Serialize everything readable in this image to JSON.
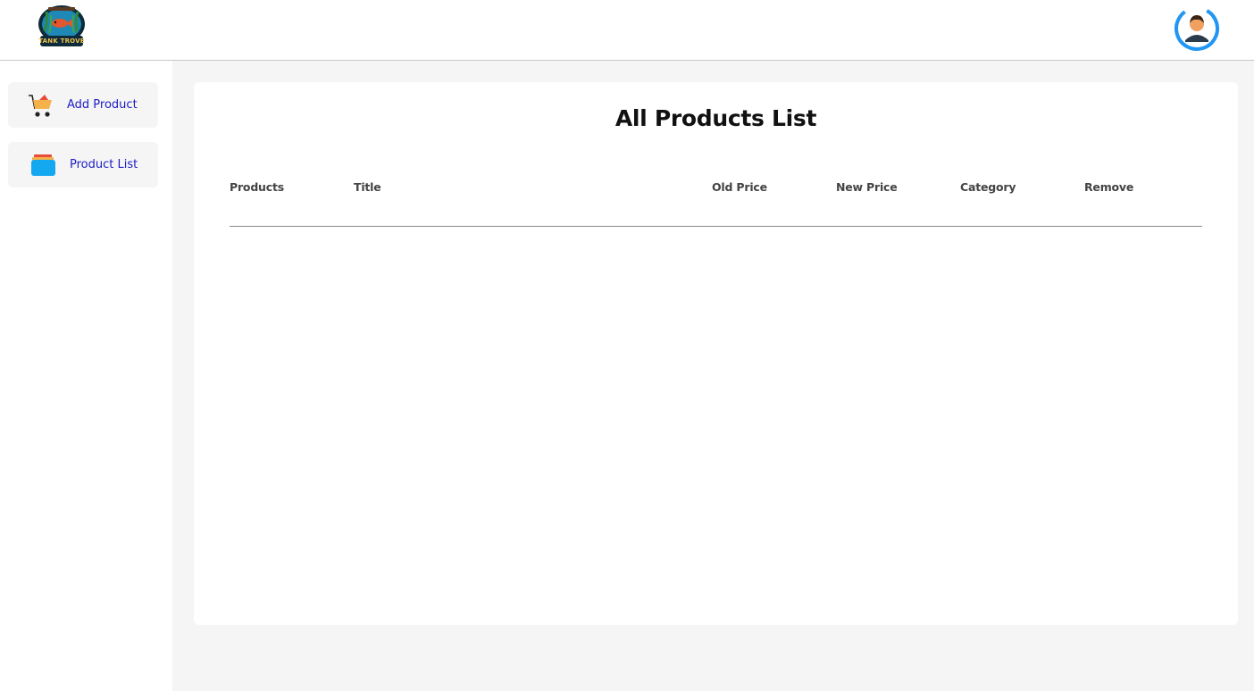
{
  "brand": {
    "logo_text": "TANK TROVE"
  },
  "sidebar": {
    "items": [
      {
        "label": "Add Product",
        "icon": "cart-icon"
      },
      {
        "label": "Product List",
        "icon": "list-stack-icon"
      }
    ]
  },
  "main": {
    "title": "All Products List",
    "columns": [
      "Products",
      "Title",
      "Old Price",
      "New Price",
      "Category",
      "Remove"
    ],
    "rows": []
  },
  "colors": {
    "accent_link": "#1c1cc4",
    "avatar_ring": "#2196f3",
    "sidebar_item_bg": "#f5f5f5",
    "main_bg": "#f5f5f5"
  }
}
